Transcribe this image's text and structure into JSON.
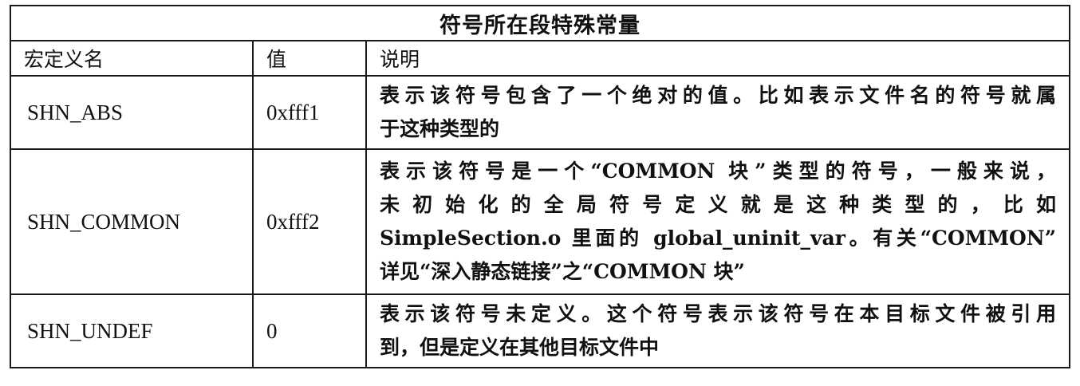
{
  "table": {
    "title": "符号所在段特殊常量",
    "headers": [
      "宏定义名",
      "值",
      "说明"
    ],
    "rows": [
      {
        "name": "SHN_ABS",
        "value": "0xfff1",
        "description_lines": [
          "表示该符号包含了一个绝对的值。比如表示文件名的符号就属",
          "于这种类型的"
        ]
      },
      {
        "name": "SHN_COMMON",
        "value": "0xfff2",
        "description_lines": [
          "表示该符号是一个“COMMON 块”类型的符号，一般来说，",
          "未初始化的全局符号定义就是这种类型的，比如",
          "SimpleSection.o 里面的 global_uninit_var。有关“COMMON”",
          "详见“深入静态链接”之“COMMON 块”"
        ]
      },
      {
        "name": "SHN_UNDEF",
        "value": "0",
        "description_lines": [
          "表示该符号未定义。这个符号表示该符号在本目标文件被引用",
          "到，但是定义在其他目标文件中"
        ]
      }
    ]
  }
}
